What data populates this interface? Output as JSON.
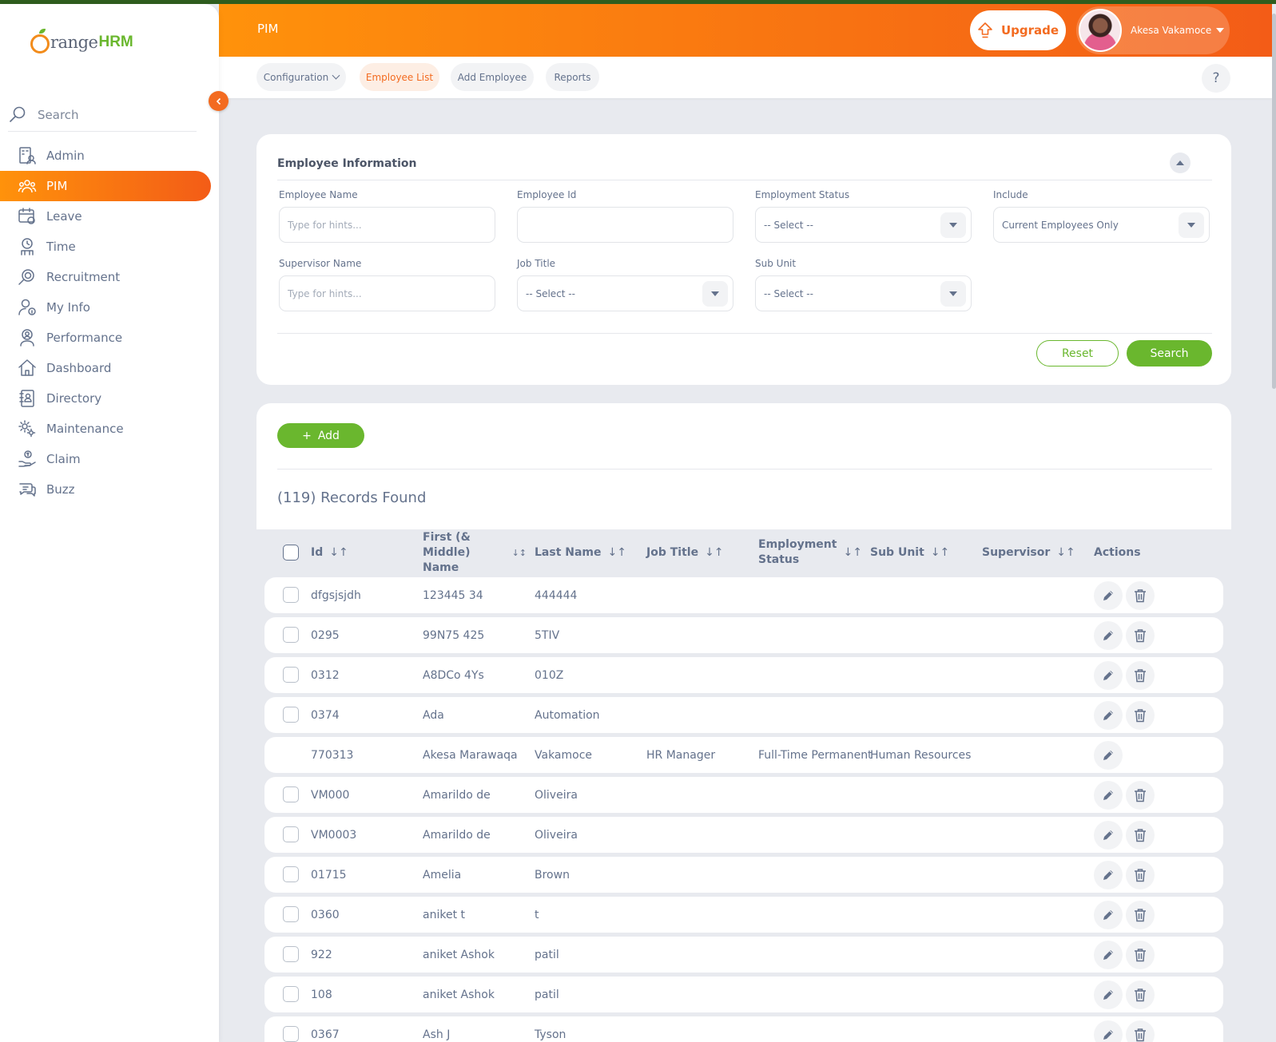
{
  "app": {
    "logo_text": "range",
    "logo_hrm": "HRM",
    "module_title": "PIM",
    "upgrade_label": "Upgrade",
    "user_name": "Akesa Vakamoce",
    "accent_color": "#f36b20",
    "primary_green": "#6ab72e"
  },
  "sidebar": {
    "search_placeholder": "Search",
    "items": [
      {
        "label": "Admin",
        "icon": "admin-icon",
        "active": false
      },
      {
        "label": "PIM",
        "icon": "pim-icon",
        "active": true
      },
      {
        "label": "Leave",
        "icon": "leave-icon",
        "active": false
      },
      {
        "label": "Time",
        "icon": "time-icon",
        "active": false
      },
      {
        "label": "Recruitment",
        "icon": "recruitment-icon",
        "active": false
      },
      {
        "label": "My Info",
        "icon": "my-info-icon",
        "active": false
      },
      {
        "label": "Performance",
        "icon": "performance-icon",
        "active": false
      },
      {
        "label": "Dashboard",
        "icon": "dashboard-icon",
        "active": false
      },
      {
        "label": "Directory",
        "icon": "directory-icon",
        "active": false
      },
      {
        "label": "Maintenance",
        "icon": "maintenance-icon",
        "active": false
      },
      {
        "label": "Claim",
        "icon": "claim-icon",
        "active": false
      },
      {
        "label": "Buzz",
        "icon": "buzz-icon",
        "active": false
      }
    ]
  },
  "topnav": {
    "tabs": [
      {
        "label": "Configuration",
        "active": false,
        "dropdown": true
      },
      {
        "label": "Employee List",
        "active": true
      },
      {
        "label": "Add Employee",
        "active": false
      },
      {
        "label": "Reports",
        "active": false
      }
    ],
    "help_label": "?"
  },
  "filter": {
    "title": "Employee Information",
    "employee_name": {
      "label": "Employee Name",
      "placeholder": "Type for hints...",
      "value": ""
    },
    "employee_id": {
      "label": "Employee Id",
      "value": ""
    },
    "employment_status": {
      "label": "Employment Status",
      "value": "-- Select --"
    },
    "include": {
      "label": "Include",
      "value": "Current Employees Only"
    },
    "supervisor_name": {
      "label": "Supervisor Name",
      "placeholder": "Type for hints...",
      "value": ""
    },
    "job_title": {
      "label": "Job Title",
      "value": "-- Select --"
    },
    "sub_unit": {
      "label": "Sub Unit",
      "value": "-- Select --"
    },
    "reset_label": "Reset",
    "search_label": "Search"
  },
  "list": {
    "add_label": "Add",
    "records_found": "(119) Records Found",
    "columns": [
      "Id",
      "First (& Middle) Name",
      "Last Name",
      "Job Title",
      "Employment Status",
      "Sub Unit",
      "Supervisor",
      "Actions"
    ],
    "rows": [
      {
        "id": "dfgsjsjdh",
        "first": "123445 34",
        "last": "444444",
        "job": "",
        "status": "",
        "sub": "",
        "sup": "",
        "deletable": true
      },
      {
        "id": "0295",
        "first": "99N75 425",
        "last": "5TIV",
        "job": "",
        "status": "",
        "sub": "",
        "sup": "",
        "deletable": true
      },
      {
        "id": "0312",
        "first": "A8DCo 4Ys",
        "last": "010Z",
        "job": "",
        "status": "",
        "sub": "",
        "sup": "",
        "deletable": true
      },
      {
        "id": "0374",
        "first": "Ada",
        "last": "Automation",
        "job": "",
        "status": "",
        "sub": "",
        "sup": "",
        "deletable": true
      },
      {
        "id": "770313",
        "first": "Akesa Marawaqa",
        "last": "Vakamoce",
        "job": "HR Manager",
        "status": "Full-Time Permanent",
        "sub": "Human Resources",
        "sup": "",
        "deletable": false
      },
      {
        "id": "VM000",
        "first": "Amarildo de",
        "last": "Oliveira",
        "job": "",
        "status": "",
        "sub": "",
        "sup": "",
        "deletable": true
      },
      {
        "id": "VM0003",
        "first": "Amarildo de",
        "last": "Oliveira",
        "job": "",
        "status": "",
        "sub": "",
        "sup": "",
        "deletable": true
      },
      {
        "id": "01715",
        "first": "Amelia",
        "last": "Brown",
        "job": "",
        "status": "",
        "sub": "",
        "sup": "",
        "deletable": true
      },
      {
        "id": "0360",
        "first": "aniket t",
        "last": "t",
        "job": "",
        "status": "",
        "sub": "",
        "sup": "",
        "deletable": true
      },
      {
        "id": "922",
        "first": "aniket Ashok",
        "last": "patil",
        "job": "",
        "status": "",
        "sub": "",
        "sup": "",
        "deletable": true
      },
      {
        "id": "108",
        "first": "aniket Ashok",
        "last": "patil",
        "job": "",
        "status": "",
        "sub": "",
        "sup": "",
        "deletable": true
      },
      {
        "id": "0367",
        "first": "Ash J",
        "last": "Tyson",
        "job": "",
        "status": "",
        "sub": "",
        "sup": "",
        "deletable": true
      }
    ]
  }
}
